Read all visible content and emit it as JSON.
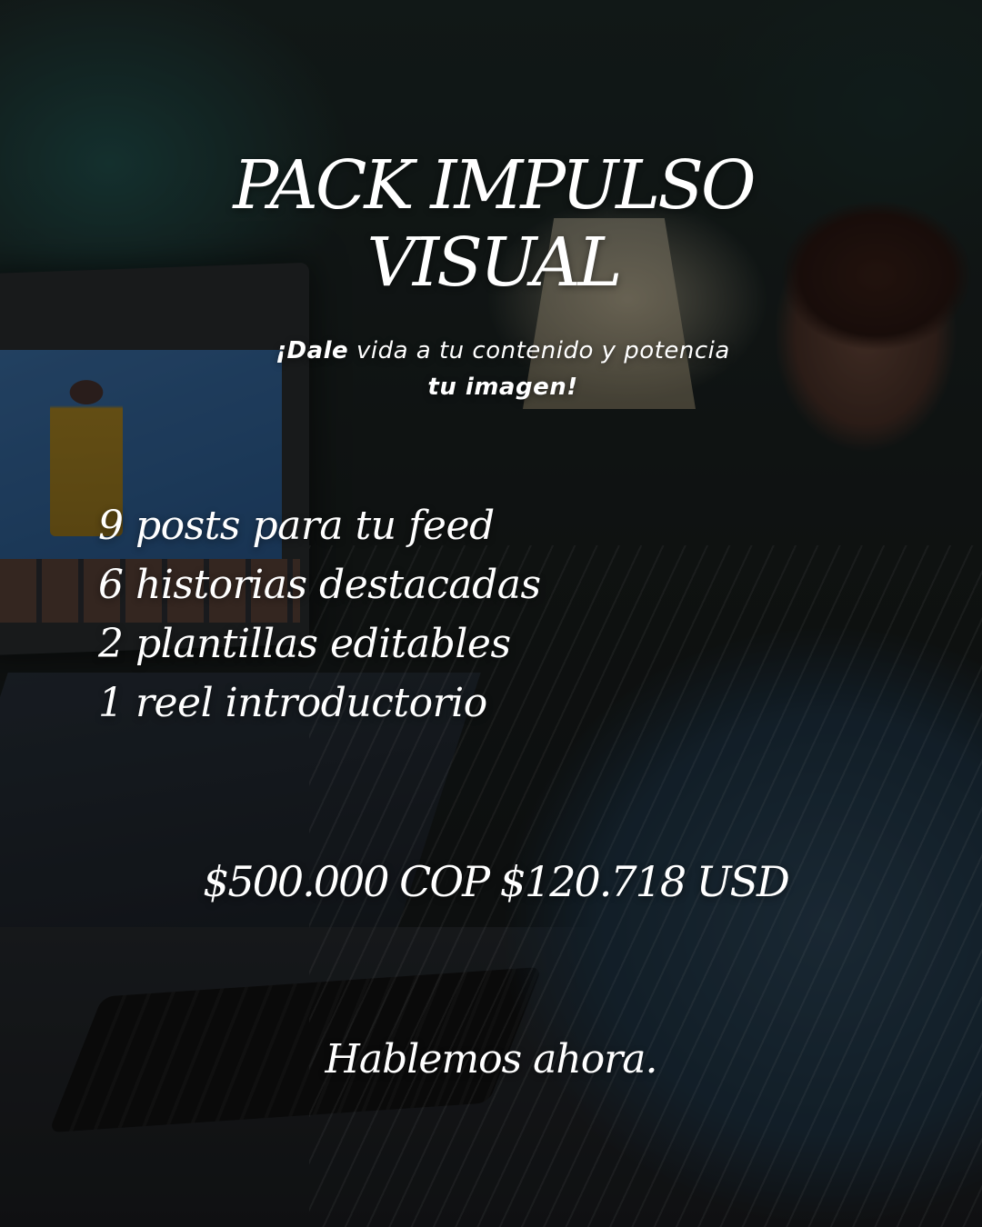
{
  "title": {
    "line1": "PACK IMPULSO",
    "line2": "VISUAL"
  },
  "subtitle": {
    "bold_start": "¡Dale",
    "line1_rest": " vida a tu contenido y potencia",
    "line2_bold": "tu imagen!"
  },
  "features": [
    "9 posts para tu feed",
    "6 historias destacadas",
    "2 plantillas editables",
    "1 reel introductorio"
  ],
  "price": "$500.000 COP $120.718 USD",
  "cta": "Hablemos ahora."
}
